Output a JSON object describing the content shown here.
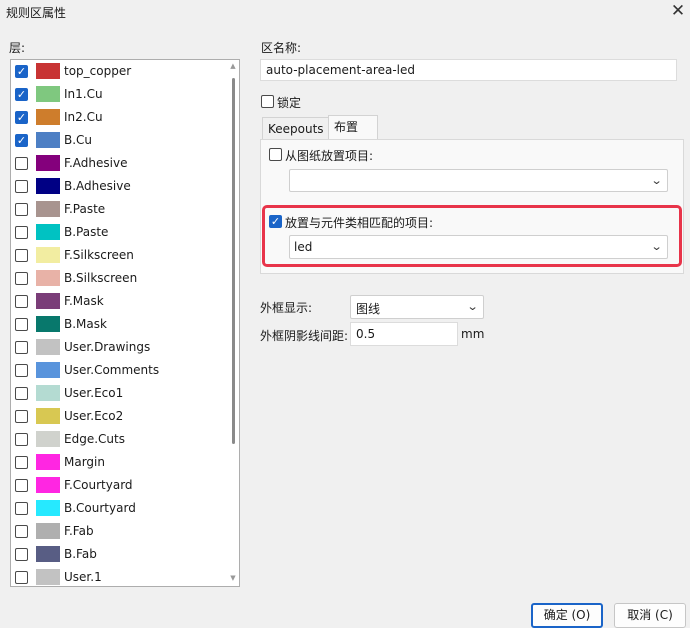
{
  "window": {
    "title": "规则区属性",
    "close_icon": "✕"
  },
  "layers": {
    "label": "层:",
    "items": [
      {
        "name": "top_copper",
        "color": "#c83434",
        "checked": true
      },
      {
        "name": "In1.Cu",
        "color": "#7fc87f",
        "checked": true
      },
      {
        "name": "In2.Cu",
        "color": "#ce7d2c",
        "checked": true
      },
      {
        "name": "B.Cu",
        "color": "#4d7fc4",
        "checked": true
      },
      {
        "name": "F.Adhesive",
        "color": "#84007c",
        "checked": false
      },
      {
        "name": "B.Adhesive",
        "color": "#000084",
        "checked": false
      },
      {
        "name": "F.Paste",
        "color": "#a8948f",
        "checked": false
      },
      {
        "name": "B.Paste",
        "color": "#00c2c2",
        "checked": false
      },
      {
        "name": "F.Silkscreen",
        "color": "#f2eda1",
        "checked": false
      },
      {
        "name": "B.Silkscreen",
        "color": "#e8b2a7",
        "checked": false
      },
      {
        "name": "F.Mask",
        "color": "#7a3d78",
        "checked": false
      },
      {
        "name": "B.Mask",
        "color": "#08786c",
        "checked": false
      },
      {
        "name": "User.Drawings",
        "color": "#c2c2c2",
        "checked": false
      },
      {
        "name": "User.Comments",
        "color": "#5994dc",
        "checked": false
      },
      {
        "name": "User.Eco1",
        "color": "#b4dbd2",
        "checked": false
      },
      {
        "name": "User.Eco2",
        "color": "#d8c852",
        "checked": false
      },
      {
        "name": "Edge.Cuts",
        "color": "#d0d2cd",
        "checked": false
      },
      {
        "name": "Margin",
        "color": "#ff26e2",
        "checked": false
      },
      {
        "name": "F.Courtyard",
        "color": "#ff26e2",
        "checked": false
      },
      {
        "name": "B.Courtyard",
        "color": "#26e9ff",
        "checked": false
      },
      {
        "name": "F.Fab",
        "color": "#afafaf",
        "checked": false
      },
      {
        "name": "B.Fab",
        "color": "#585d84",
        "checked": false
      },
      {
        "name": "User.1",
        "color": "#c2c2c2",
        "checked": false
      }
    ]
  },
  "zone": {
    "name_label": "区名称:",
    "name_value": "auto-placement-area-led",
    "lock_label": "锁定",
    "lock_checked": false
  },
  "tabs": [
    {
      "label": "Keepouts",
      "active": false
    },
    {
      "label": "布置",
      "active": true
    }
  ],
  "placement": {
    "sheet_label": "从图纸放置项目:",
    "sheet_checked": false,
    "sheet_value": "",
    "match_label": "放置与元件类相匹配的项目:",
    "match_checked": true,
    "match_value": "led"
  },
  "outline": {
    "display_label": "外框显示:",
    "display_value": "图线",
    "hatch_label": "外框阴影线间距:",
    "hatch_value": "0.5",
    "hatch_unit": "mm"
  },
  "buttons": {
    "ok": "确定 (O)",
    "cancel": "取消 (C)"
  },
  "colors": {
    "accent": "#1a64c8",
    "highlight": "#e8344a"
  }
}
